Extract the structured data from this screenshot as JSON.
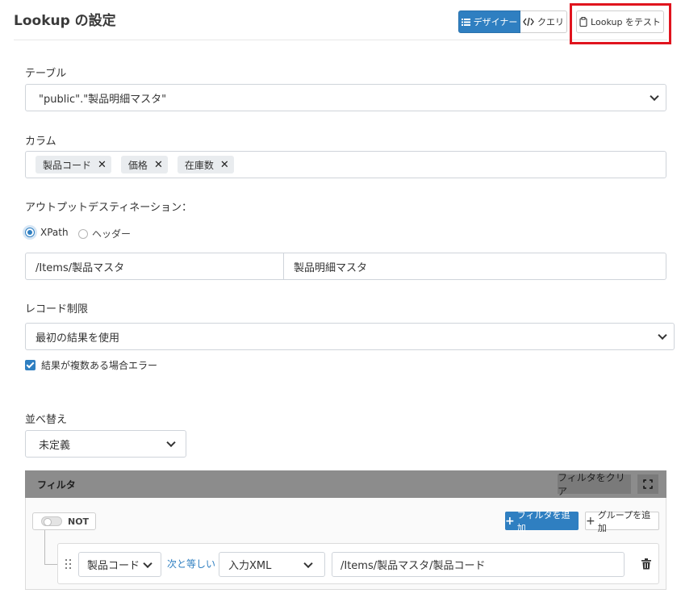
{
  "header": {
    "title": "Lookup の設定",
    "designer_label": "デザイナー",
    "query_label": "クエリ",
    "test_label": "Lookup をテスト"
  },
  "table_section": {
    "label": "テーブル",
    "value": "\"public\".\"製品明細マスタ\""
  },
  "column_section": {
    "label": "カラム",
    "chips": [
      "製品コード",
      "価格",
      "在庫数"
    ],
    "remove_glyph": "✕"
  },
  "output_section": {
    "label": "アウトプットデスティネーション：",
    "options": [
      "XPath",
      "ヘッダー"
    ],
    "selected": "XPath",
    "xpath_value": "/Items/製品マスタ",
    "name_value": "製品明細マスタ"
  },
  "record_section": {
    "label": "レコード制限",
    "value": "最初の結果を使用",
    "checkbox_label": "結果が複数ある場合エラー",
    "checkbox_checked": true
  },
  "sort_section": {
    "label": "並べ替え",
    "value": "未定義"
  },
  "filter_section": {
    "title": "フィルタ",
    "clear_label": "フィルタをクリア",
    "not_label": "NOT",
    "add_filter_label": "フィルタを追加",
    "add_group_label": "グループを追加",
    "rule": {
      "field": "製品コード",
      "operator": "次と等しい",
      "source": "入力XML",
      "value": "/Items/製品マスタ/製品コード"
    }
  },
  "colors": {
    "accent": "#2f7fc1",
    "highlight": "#e0141e",
    "filter_header": "#8c8c8c"
  }
}
